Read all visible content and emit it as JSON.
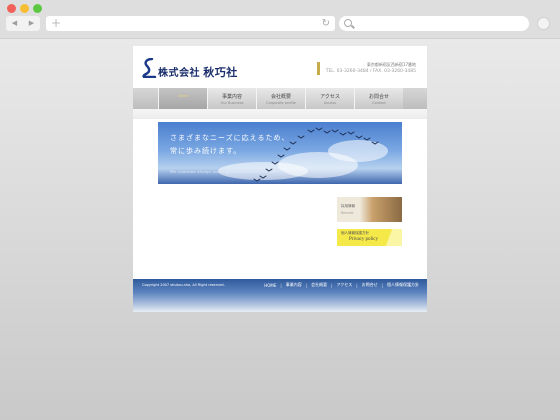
{
  "browser": {
    "back_icon": "◀",
    "forward_icon": "▶",
    "new_tab_icon": "+",
    "reload_icon": "↻",
    "url_value": "",
    "search_value": ""
  },
  "site": {
    "logo_text": "株式会社",
    "logo_name": "秋巧社",
    "address": "東京都新宿区西新宿17番地",
    "tel_fax": "TEL. 03-3260-3484 / FAX. 03-3260-3485",
    "brand_color": "#1b2e6b",
    "accent_color": "#c6ad4c"
  },
  "nav": {
    "items": [
      {
        "ja": "",
        "en": "Home"
      },
      {
        "ja": "事業内容",
        "en": "Our Business"
      },
      {
        "ja": "会社概要",
        "en": "Corporate profile"
      },
      {
        "ja": "アクセス",
        "en": "Access"
      },
      {
        "ja": "お問合せ",
        "en": "Contact"
      }
    ]
  },
  "hero": {
    "line1": "さまざまなニーズに応えるため、",
    "line2": "常に歩み続けます。",
    "en": "We continue always walking it to meet various needs."
  },
  "banners": {
    "recruit_title": "採用情報",
    "recruit_en": "Recruit",
    "privacy_title": "個人情報保護方針",
    "privacy_en": "Privacy policy"
  },
  "footer": {
    "copyright": "Copyright 2007 shukou-sha, All Right reserved.",
    "links": [
      "HOME",
      "事業内容",
      "会社概要",
      "アクセス",
      "お問合せ",
      "個人情報保護方針"
    ],
    "separator": "|"
  }
}
